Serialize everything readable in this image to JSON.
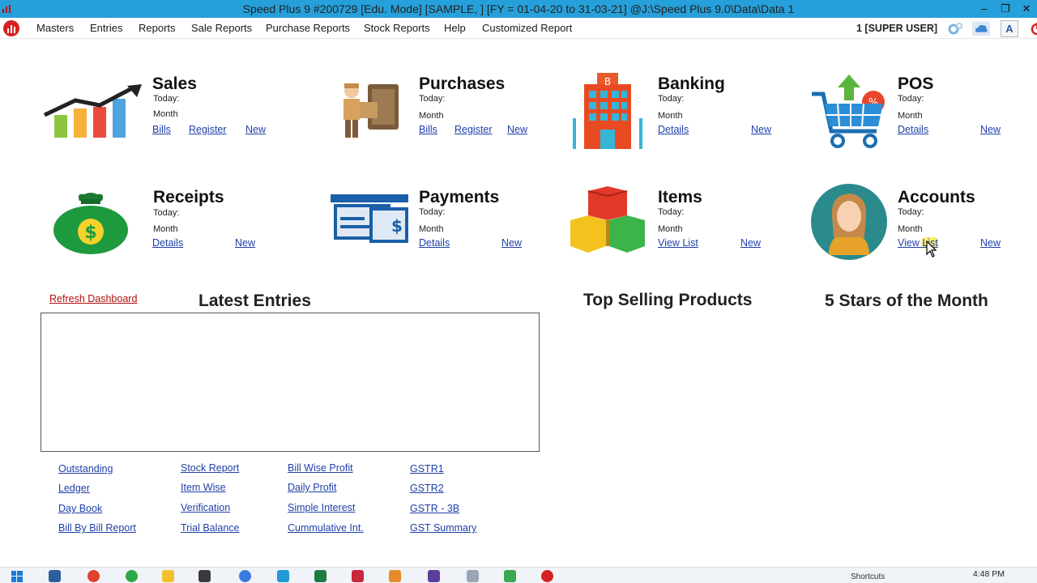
{
  "window": {
    "title": "Speed Plus 9 #200729  [Edu. Mode]  [SAMPLE, ]  [FY = 01-04-20 to 31-03-21]   @J:\\Speed Plus 9.0\\Data\\Data 1",
    "minimize": "–",
    "restore": "❐",
    "close": "✕"
  },
  "menu": {
    "items": [
      "Masters",
      "Entries",
      "Reports",
      "Sale Reports",
      "Purchase Reports",
      "Stock Reports",
      "Help",
      "Customized Report"
    ],
    "user": "1 [SUPER USER]",
    "font_button": "A"
  },
  "cards": {
    "sales": {
      "title": "Sales",
      "today": "Today:",
      "month": "Month",
      "link1": "Bills",
      "link2": "Register",
      "link3": "New"
    },
    "purchases": {
      "title": "Purchases",
      "today": "Today:",
      "month": "Month",
      "link1": "Bills",
      "link2": "Register",
      "link3": "New"
    },
    "banking": {
      "title": "Banking",
      "today": "Today:",
      "month": "Month",
      "link1": "Details",
      "link3": "New"
    },
    "pos": {
      "title": "POS",
      "today": "Today:",
      "month": "Month",
      "link1": "Details",
      "link3": "New"
    },
    "receipts": {
      "title": "Receipts",
      "today": "Today:",
      "month": "Month",
      "link1": "Details",
      "link3": "New"
    },
    "payments": {
      "title": "Payments",
      "today": "Today:",
      "month": "Month",
      "link1": "Details",
      "link3": "New"
    },
    "items": {
      "title": "Items",
      "today": "Today:",
      "month": "Month",
      "link1": "View List",
      "link3": "New"
    },
    "accounts": {
      "title": "Accounts",
      "today": "Today:",
      "month": "Month",
      "link1": "View List",
      "link3": "New"
    }
  },
  "dashboard": {
    "refresh": "Refresh Dashboard",
    "latest_entries": "Latest Entries",
    "top_selling": "Top Selling Products",
    "five_stars": "5 Stars of the Month"
  },
  "quick_links": {
    "col1": [
      "Outstanding",
      "Ledger",
      "Day Book",
      "Bill By Bill Report"
    ],
    "col2": [
      "Stock Report",
      "Item Wise",
      "Verification",
      "Trial Balance"
    ],
    "col3": [
      "Bill Wise Profit",
      "Daily Profit",
      "Simple Interest",
      "Cummulative Int."
    ],
    "col4": [
      "GSTR1",
      "GSTR2",
      "GSTR - 3B",
      "GST Summary"
    ]
  },
  "taskbar": {
    "shortcuts": "Shortcuts",
    "time": "4:48 PM"
  },
  "colors": {
    "titlebar": "#26a0da",
    "link": "#1f3fa8",
    "refresh_link": "#b01010"
  }
}
